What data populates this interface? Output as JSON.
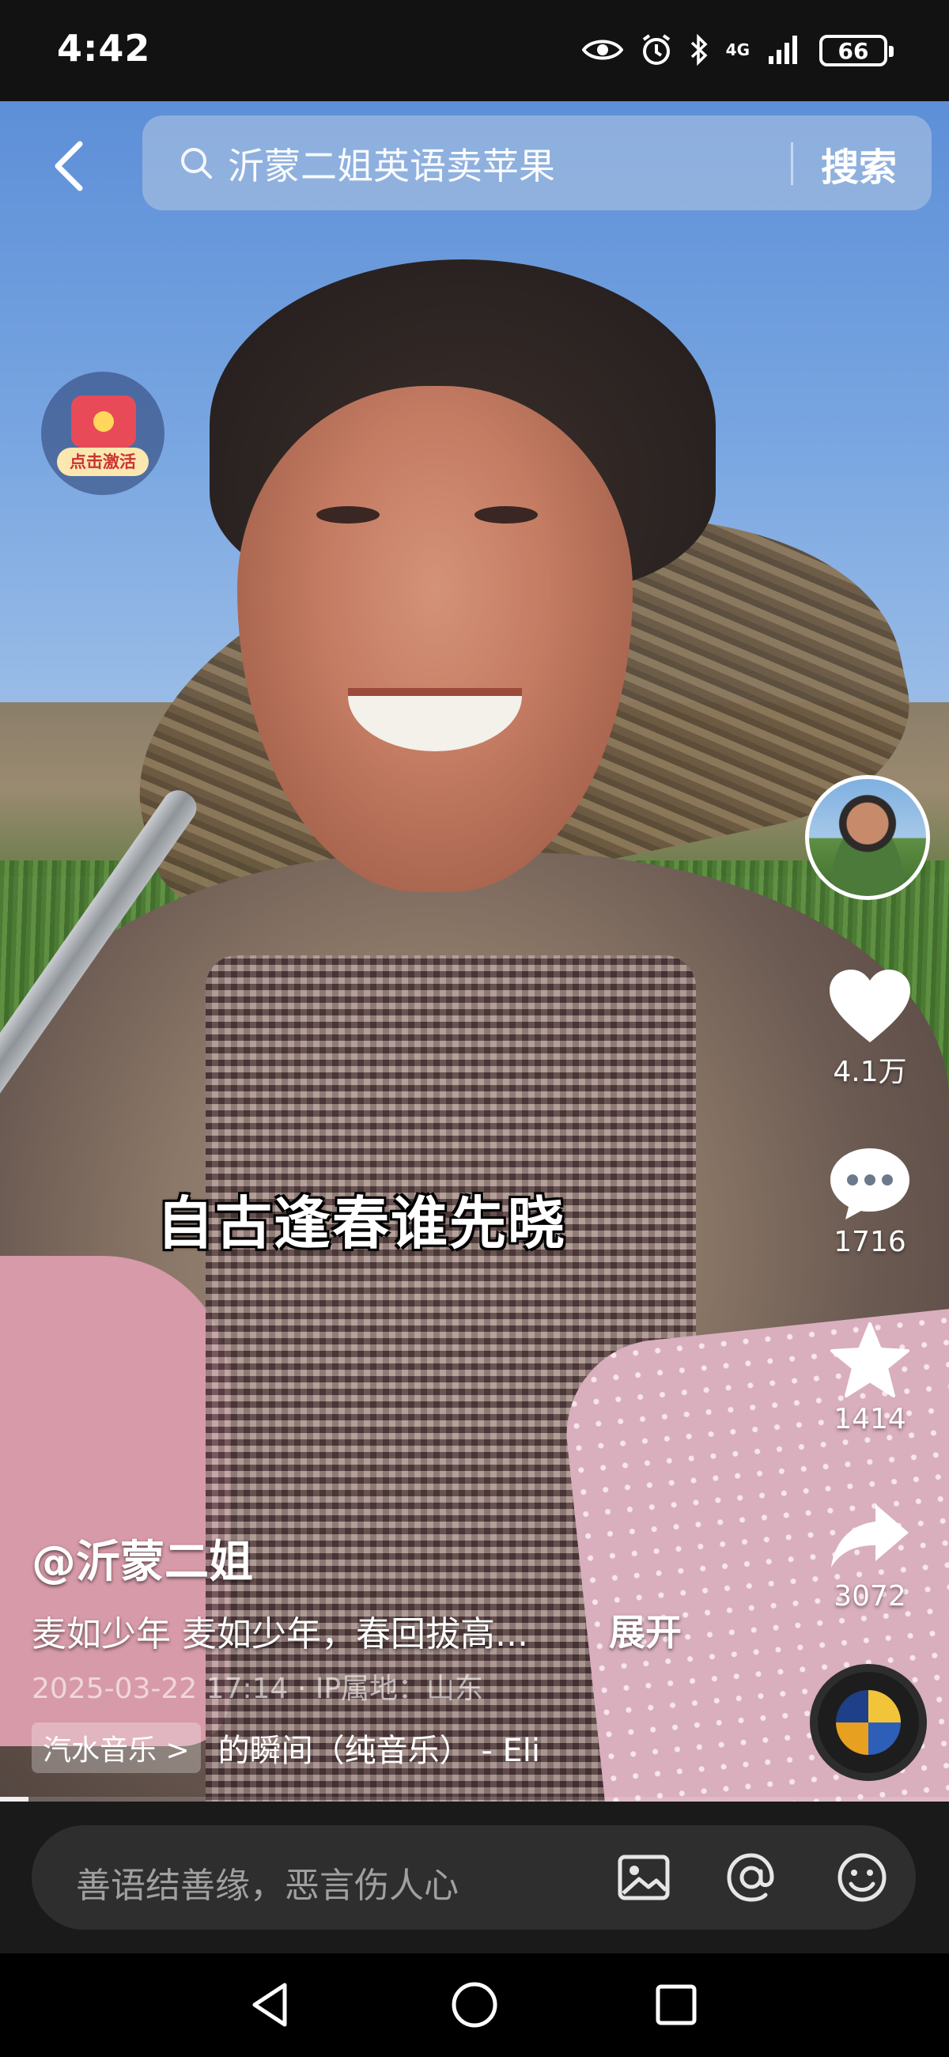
{
  "status_bar": {
    "time": "4:42",
    "network": "4G",
    "battery": "66"
  },
  "search": {
    "query": "沂蒙二姐英语卖苹果",
    "button_label": "搜索"
  },
  "activate_badge": {
    "label": "点击激活"
  },
  "actions": {
    "likes": "4.1万",
    "comments": "1716",
    "favorites": "1414",
    "shares": "3072"
  },
  "video": {
    "subtitle": "自古逢春谁先晓",
    "author": "@沂蒙二姐",
    "description": "麦如少年 麦如少年，春回拔高...",
    "expand_label": "展开",
    "meta": "2025-03-22 17:14 · IP属地：山东",
    "music_tag": "汽水音乐 >",
    "music_title": "的瞬间（纯音乐） - Eli",
    "progress": 0.03
  },
  "comment_bar": {
    "placeholder": "善语结善缘，恶言伤人心"
  },
  "icons": {
    "back": "chevron-left-icon",
    "search": "search-icon",
    "like": "heart-icon",
    "comment": "comment-icon",
    "favorite": "star-icon",
    "share": "share-arrow-icon",
    "image": "image-icon",
    "mention": "at-icon",
    "emoji": "emoji-icon"
  }
}
